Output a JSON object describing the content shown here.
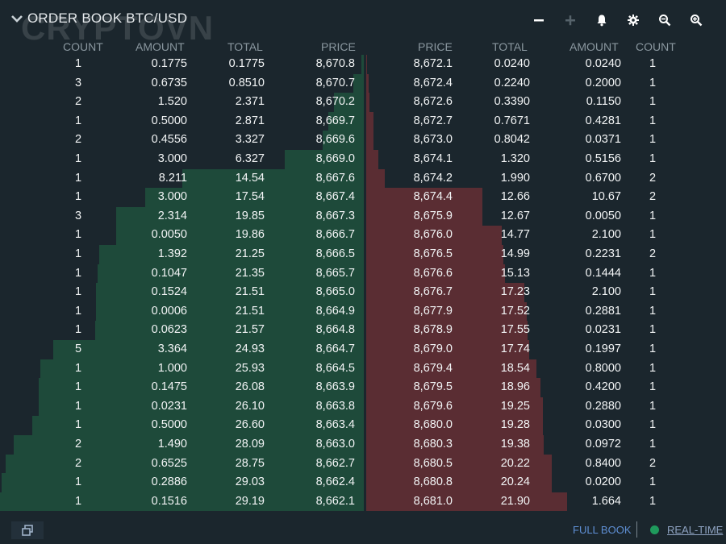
{
  "header": {
    "title": "ORDER BOOK BTC/USD",
    "watermark": "CRYPTOVN",
    "tools": [
      "minus-icon",
      "plus-icon",
      "bell-icon",
      "gear-icon",
      "zoom-out-icon",
      "zoom-in-icon"
    ]
  },
  "columns": {
    "bids": [
      "COUNT",
      "AMOUNT",
      "TOTAL",
      "PRICE"
    ],
    "asks": [
      "PRICE",
      "TOTAL",
      "AMOUNT",
      "COUNT"
    ]
  },
  "bids": [
    [
      "1",
      "0.1775",
      "0.1775",
      "8,670.8"
    ],
    [
      "3",
      "0.6735",
      "0.8510",
      "8,670.7"
    ],
    [
      "2",
      "1.520",
      "2.371",
      "8,670.2"
    ],
    [
      "1",
      "0.5000",
      "2.871",
      "8,669.7"
    ],
    [
      "2",
      "0.4556",
      "3.327",
      "8,669.6"
    ],
    [
      "1",
      "3.000",
      "6.327",
      "8,669.0"
    ],
    [
      "1",
      "8.211",
      "14.54",
      "8,667.6"
    ],
    [
      "1",
      "3.000",
      "17.54",
      "8,667.4"
    ],
    [
      "3",
      "2.314",
      "19.85",
      "8,667.3"
    ],
    [
      "1",
      "0.0050",
      "19.86",
      "8,666.7"
    ],
    [
      "1",
      "1.392",
      "21.25",
      "8,666.5"
    ],
    [
      "1",
      "0.1047",
      "21.35",
      "8,665.7"
    ],
    [
      "1",
      "0.1524",
      "21.51",
      "8,665.0"
    ],
    [
      "1",
      "0.0006",
      "21.51",
      "8,664.9"
    ],
    [
      "1",
      "0.0623",
      "21.57",
      "8,664.8"
    ],
    [
      "5",
      "3.364",
      "24.93",
      "8,664.7"
    ],
    [
      "1",
      "1.000",
      "25.93",
      "8,664.5"
    ],
    [
      "1",
      "0.1475",
      "26.08",
      "8,663.9"
    ],
    [
      "1",
      "0.0231",
      "26.10",
      "8,663.8"
    ],
    [
      "1",
      "0.5000",
      "26.60",
      "8,663.4"
    ],
    [
      "2",
      "1.490",
      "28.09",
      "8,663.0"
    ],
    [
      "2",
      "0.6525",
      "28.75",
      "8,662.7"
    ],
    [
      "1",
      "0.2886",
      "29.03",
      "8,662.4"
    ],
    [
      "1",
      "0.1516",
      "29.19",
      "8,662.1"
    ]
  ],
  "asks": [
    [
      "8,672.1",
      "0.0240",
      "0.0240",
      "1"
    ],
    [
      "8,672.4",
      "0.2240",
      "0.2000",
      "1"
    ],
    [
      "8,672.6",
      "0.3390",
      "0.1150",
      "1"
    ],
    [
      "8,672.7",
      "0.7671",
      "0.4281",
      "1"
    ],
    [
      "8,673.0",
      "0.8042",
      "0.0371",
      "1"
    ],
    [
      "8,674.1",
      "1.320",
      "0.5156",
      "1"
    ],
    [
      "8,674.2",
      "1.990",
      "0.6700",
      "2"
    ],
    [
      "8,674.4",
      "12.66",
      "10.67",
      "2"
    ],
    [
      "8,675.9",
      "12.67",
      "0.0050",
      "1"
    ],
    [
      "8,676.0",
      "14.77",
      "2.100",
      "1"
    ],
    [
      "8,676.5",
      "14.99",
      "0.2231",
      "2"
    ],
    [
      "8,676.6",
      "15.13",
      "0.1444",
      "1"
    ],
    [
      "8,676.7",
      "17.23",
      "2.100",
      "1"
    ],
    [
      "8,677.9",
      "17.52",
      "0.2881",
      "1"
    ],
    [
      "8,678.9",
      "17.55",
      "0.0231",
      "1"
    ],
    [
      "8,679.0",
      "17.74",
      "0.1997",
      "1"
    ],
    [
      "8,679.4",
      "18.54",
      "0.8000",
      "1"
    ],
    [
      "8,679.5",
      "18.96",
      "0.4200",
      "1"
    ],
    [
      "8,679.6",
      "19.25",
      "0.2880",
      "1"
    ],
    [
      "8,680.0",
      "19.28",
      "0.0300",
      "1"
    ],
    [
      "8,680.3",
      "19.38",
      "0.0972",
      "1"
    ],
    [
      "8,680.5",
      "20.22",
      "0.8400",
      "2"
    ],
    [
      "8,680.8",
      "20.24",
      "0.0200",
      "1"
    ],
    [
      "8,681.0",
      "21.90",
      "1.664",
      "1"
    ]
  ],
  "depth_scale_max": 29.19,
  "colors": {
    "bid": "#1e4a3a",
    "ask": "#5a2d33",
    "live": "#1f9a5c",
    "link": "#5f8fd4"
  },
  "footer": {
    "full_book": "FULL BOOK",
    "realtime": "REAL-TIME"
  }
}
